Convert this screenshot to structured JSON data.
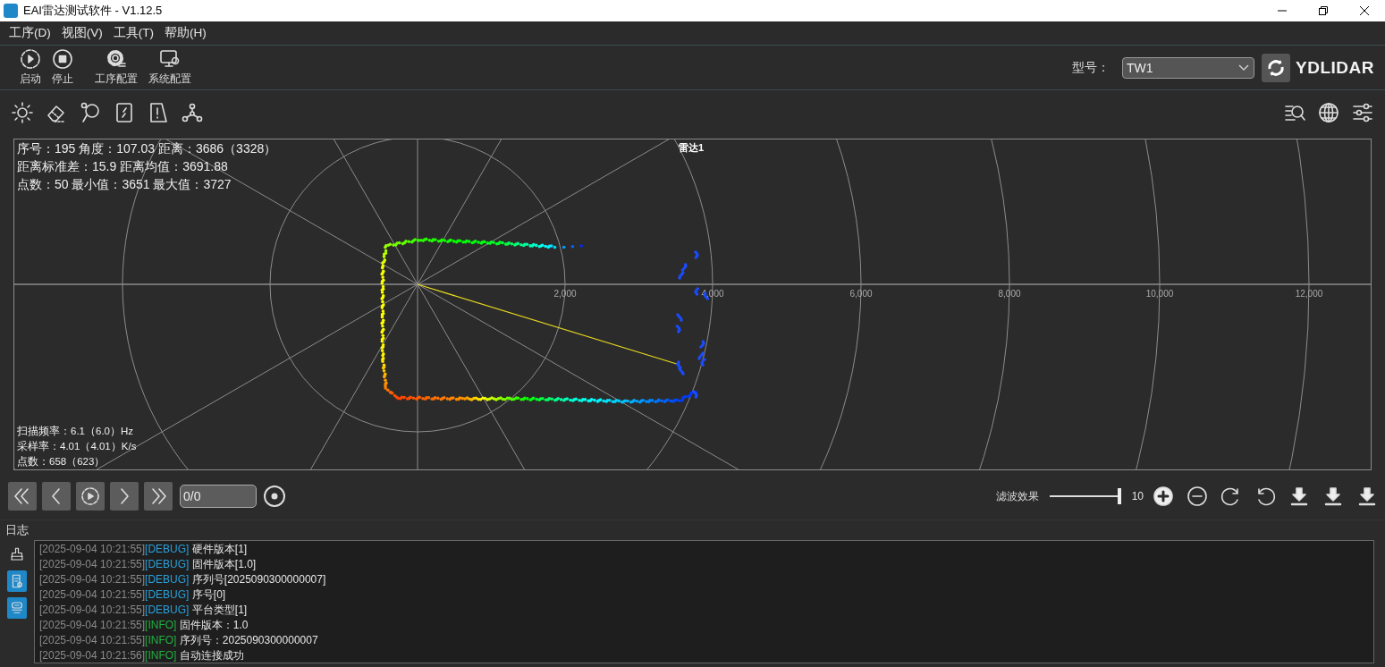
{
  "window": {
    "title": "EAI雷达测试软件 - V1.12.5"
  },
  "menu": [
    "工序(D)",
    "视图(V)",
    "工具(T)",
    "帮助(H)"
  ],
  "toolbar": [
    {
      "kind": "start",
      "label": "启动"
    },
    {
      "kind": "stop",
      "label": "停止"
    },
    {
      "kind": "process",
      "label": "工序配置"
    },
    {
      "kind": "system",
      "label": "系统配置"
    }
  ],
  "model": {
    "label": "型号：",
    "value": "TW1"
  },
  "logo": {
    "text": "YDLIDAR"
  },
  "plot": {
    "title": "雷达1",
    "info": [
      "序号：195 角度：107.03 距离：3686（3328）",
      "距离标准差：15.9 距离均值：3691.88",
      "点数：50 最小值：3651 最大值：3727"
    ],
    "stats": [
      "扫描频率：6.1（6.0）Hz",
      "采样率：4.01（4.01）K/s",
      "点数：658（623）"
    ],
    "range_labels": [
      "2,000",
      "4,000",
      "6,000",
      "8,000",
      "10,000",
      "12,000"
    ]
  },
  "playback": {
    "position": "0/0"
  },
  "filter": {
    "label": "滤波效果",
    "level": 1.0,
    "value": "10"
  },
  "log": {
    "title": "日志",
    "side_buttons": [
      {
        "kind": "clear",
        "selected": false
      },
      {
        "kind": "log",
        "selected": true
      },
      {
        "kind": "device",
        "selected": true
      }
    ],
    "entries": [
      {
        "time": "[2025-09-04 10:21:55]",
        "kind": "debug",
        "tag": "[DEBUG]",
        "message": "硬件版本[1]"
      },
      {
        "time": "[2025-09-04 10:21:55]",
        "kind": "debug",
        "tag": "[DEBUG]",
        "message": "固件版本[1.0]"
      },
      {
        "time": "[2025-09-04 10:21:55]",
        "kind": "debug",
        "tag": "[DEBUG]",
        "message": "序列号[2025090300000007]"
      },
      {
        "time": "[2025-09-04 10:21:55]",
        "kind": "debug",
        "tag": "[DEBUG]",
        "message": "序号[0]"
      },
      {
        "time": "[2025-09-04 10:21:55]",
        "kind": "debug",
        "tag": "[DEBUG]",
        "message": "平台类型[1]"
      },
      {
        "time": "[2025-09-04 10:21:55]",
        "kind": "info",
        "tag": "[INFO]",
        "message": "固件版本：1.0"
      },
      {
        "time": "[2025-09-04 10:21:55]",
        "kind": "info",
        "tag": "[INFO]",
        "message": "序列号：2025090300000007"
      },
      {
        "time": "[2025-09-04 10:21:56]",
        "kind": "info",
        "tag": "[INFO]",
        "message": "自动连接成功"
      }
    ]
  }
}
